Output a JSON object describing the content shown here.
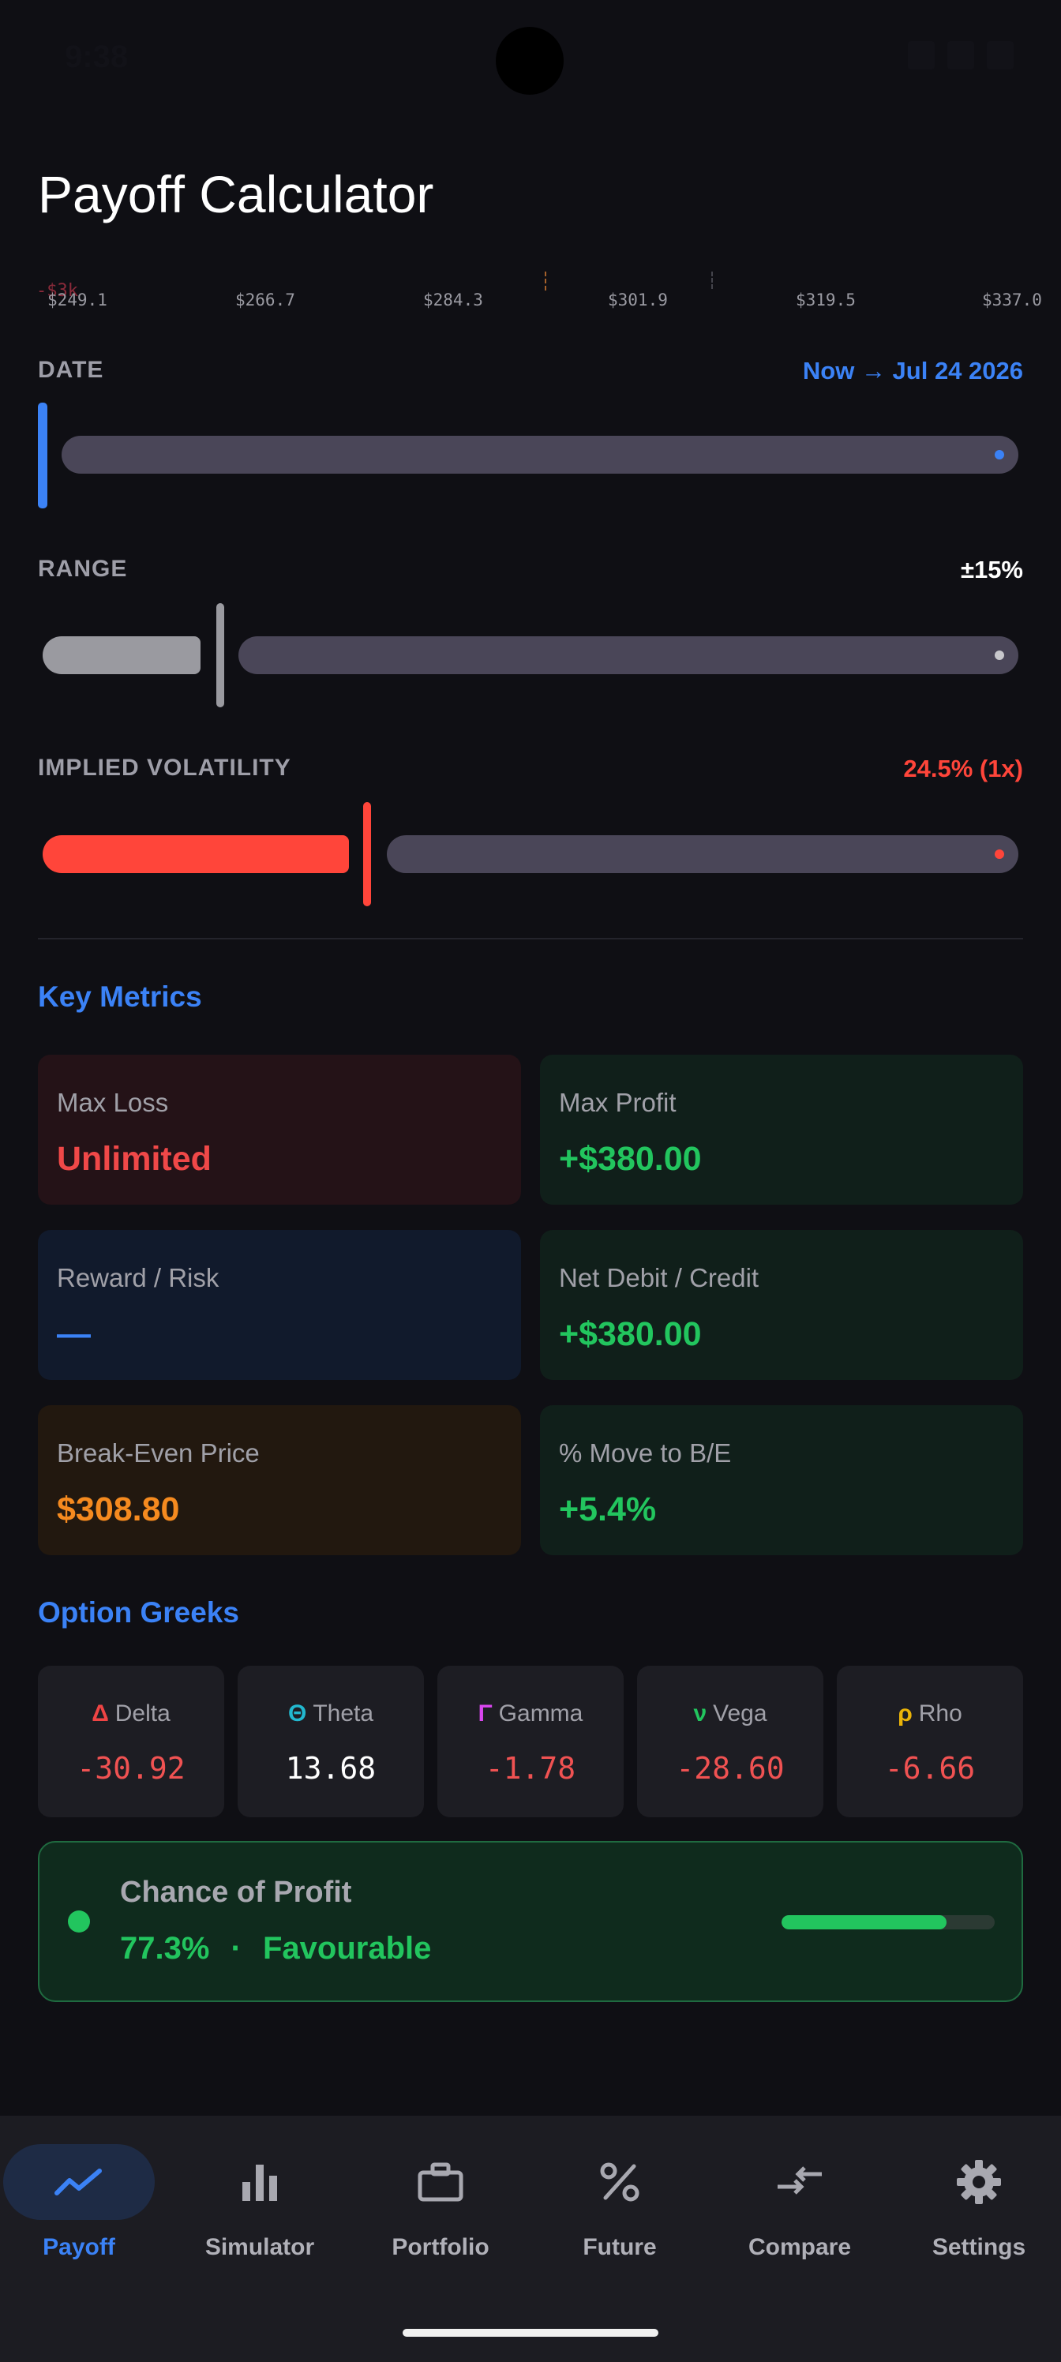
{
  "status_bar": {
    "time": "9:38"
  },
  "page_title": "Payoff Calculator",
  "chart_axis": {
    "neg_label": "-$3k",
    "ticks": [
      "$249.1",
      "$266.7",
      "$284.3",
      "$301.9",
      "$319.5",
      "$337.0"
    ]
  },
  "sliders": {
    "date": {
      "label": "DATE",
      "value": "Now → Jul 24 2026",
      "position": 0.0,
      "color": "#3b82f6"
    },
    "range": {
      "label": "RANGE",
      "value": "±15%",
      "position": 0.18,
      "color": "#a0a0a6"
    },
    "iv": {
      "label": "IMPLIED VOLATILITY",
      "value": "24.5% (1x)",
      "position": 0.33,
      "color": "#ff453a"
    }
  },
  "key_metrics": {
    "heading": "Key Metrics",
    "max_loss": {
      "label": "Max Loss",
      "value": "Unlimited"
    },
    "max_profit": {
      "label": "Max Profit",
      "value": "+$380.00"
    },
    "reward_risk": {
      "label": "Reward / Risk",
      "value": "—"
    },
    "net_debit": {
      "label": "Net Debit / Credit",
      "value": "+$380.00"
    },
    "break_even": {
      "label": "Break-Even Price",
      "value": "$308.80"
    },
    "move_be": {
      "label": "% Move to B/E",
      "value": "+5.4%"
    }
  },
  "greeks": {
    "heading": "Option Greeks",
    "items": [
      {
        "symbol": "Δ",
        "name": "Delta",
        "value": "-30.92",
        "symbol_color": "#ef4444",
        "value_color": "#f05252"
      },
      {
        "symbol": "Θ",
        "name": "Theta",
        "value": "13.68",
        "symbol_color": "#22b8cf",
        "value_color": "#ffffff"
      },
      {
        "symbol": "Γ",
        "name": "Gamma",
        "value": "-1.78",
        "symbol_color": "#d946ef",
        "value_color": "#f05252"
      },
      {
        "symbol": "ν",
        "name": "Vega",
        "value": "-28.60",
        "symbol_color": "#22c55e",
        "value_color": "#f05252"
      },
      {
        "symbol": "ρ",
        "name": "Rho",
        "value": "-6.66",
        "symbol_color": "#eab308",
        "value_color": "#f05252"
      }
    ]
  },
  "chance_of_profit": {
    "title": "Chance of Profit",
    "percent": "77.3%",
    "separator": "·",
    "verdict": "Favourable",
    "fraction": 0.773
  },
  "nav": {
    "items": [
      {
        "label": "Payoff",
        "icon": "trending-up-icon",
        "active": true
      },
      {
        "label": "Simulator",
        "icon": "bar-chart-icon",
        "active": false
      },
      {
        "label": "Portfolio",
        "icon": "briefcase-icon",
        "active": false
      },
      {
        "label": "Future",
        "icon": "percent-icon",
        "active": false
      },
      {
        "label": "Compare",
        "icon": "compare-arrows-icon",
        "active": false
      },
      {
        "label": "Settings",
        "icon": "gear-icon",
        "active": false
      }
    ]
  }
}
